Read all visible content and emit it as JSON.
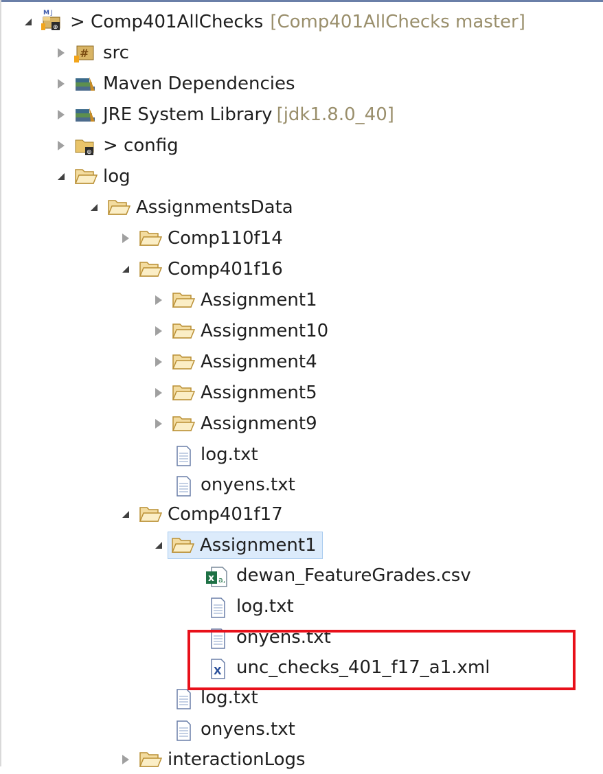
{
  "colors": {
    "highlight": "#e8101a",
    "selection": "#dcebfb",
    "decoration": "#9a8f6c"
  },
  "tree": [
    {
      "label": "> Comp401AllChecks",
      "decoration": "[Comp401AllChecks master]",
      "icon": "maven-project-icon",
      "state": "expanded"
    },
    {
      "label": "src",
      "icon": "source-folder-icon",
      "state": "collapsed"
    },
    {
      "label": "Maven Dependencies",
      "icon": "library-icon",
      "state": "collapsed"
    },
    {
      "label": "JRE System Library",
      "decoration": "[jdk1.8.0_40]",
      "icon": "library-icon",
      "state": "collapsed"
    },
    {
      "label": "> config",
      "icon": "folder-git-icon",
      "state": "collapsed"
    },
    {
      "label": "log",
      "icon": "folder-icon",
      "state": "expanded"
    },
    {
      "label": "AssignmentsData",
      "icon": "folder-icon",
      "state": "expanded"
    },
    {
      "label": "Comp110f14",
      "icon": "folder-icon",
      "state": "collapsed"
    },
    {
      "label": "Comp401f16",
      "icon": "folder-icon",
      "state": "expanded"
    },
    {
      "label": "Assignment1",
      "icon": "folder-icon",
      "state": "collapsed"
    },
    {
      "label": "Assignment10",
      "icon": "folder-icon",
      "state": "collapsed"
    },
    {
      "label": "Assignment4",
      "icon": "folder-icon",
      "state": "collapsed"
    },
    {
      "label": "Assignment5",
      "icon": "folder-icon",
      "state": "collapsed"
    },
    {
      "label": "Assignment9",
      "icon": "folder-icon",
      "state": "collapsed"
    },
    {
      "label": "log.txt",
      "icon": "text-file-icon",
      "state": "leaf"
    },
    {
      "label": "onyens.txt",
      "icon": "text-file-icon",
      "state": "leaf"
    },
    {
      "label": "Comp401f17",
      "icon": "folder-icon",
      "state": "expanded"
    },
    {
      "label": "Assignment1",
      "icon": "folder-icon",
      "state": "expanded",
      "selected": true
    },
    {
      "label": "dewan_FeatureGrades.csv",
      "icon": "csv-file-icon",
      "state": "leaf"
    },
    {
      "label": "log.txt",
      "icon": "text-file-icon",
      "state": "leaf"
    },
    {
      "label": "onyens.txt",
      "icon": "text-file-icon",
      "state": "leaf"
    },
    {
      "label": "unc_checks_401_f17_a1.xml",
      "icon": "xml-file-icon",
      "state": "leaf"
    },
    {
      "label": "log.txt",
      "icon": "text-file-icon",
      "state": "leaf"
    },
    {
      "label": "onyens.txt",
      "icon": "text-file-icon",
      "state": "leaf"
    },
    {
      "label": "interactionLogs",
      "icon": "folder-icon",
      "state": "collapsed"
    }
  ]
}
